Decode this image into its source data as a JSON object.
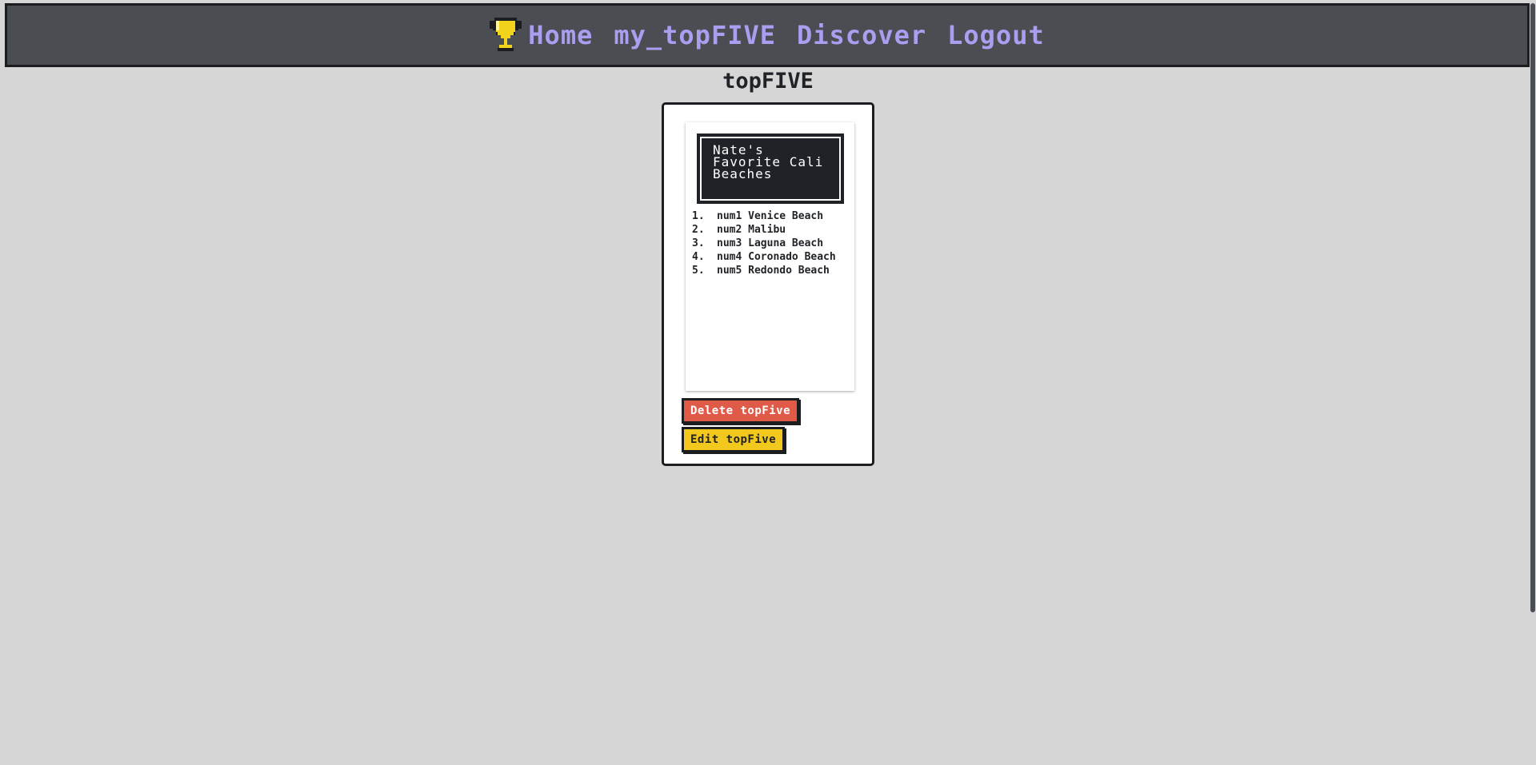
{
  "nav": {
    "links": [
      {
        "label": "Home"
      },
      {
        "label": "my_topFIVE"
      },
      {
        "label": "Discover"
      },
      {
        "label": "Logout"
      }
    ]
  },
  "page": {
    "title": "topFIVE"
  },
  "card": {
    "list_title": "Nate's Favorite Cali Beaches",
    "entries": [
      {
        "number": "1.",
        "text": "num1 Venice Beach"
      },
      {
        "number": "2.",
        "text": "num2 Malibu"
      },
      {
        "number": "3.",
        "text": "num3 Laguna Beach"
      },
      {
        "number": "4.",
        "text": "num4 Coronado Beach"
      },
      {
        "number": "5.",
        "text": "num5 Redondo Beach"
      }
    ],
    "delete_label": "Delete topFive",
    "edit_label": "Edit topFive"
  },
  "colors": {
    "nav_bg": "#4a4d51",
    "nav_link": "#a99ef0",
    "page_bg": "#d6d6d6",
    "delete_button": "#e05a48",
    "edit_button": "#f2c81c",
    "trophy": "#f2d31c"
  },
  "icons": {
    "brand": "trophy-icon"
  }
}
